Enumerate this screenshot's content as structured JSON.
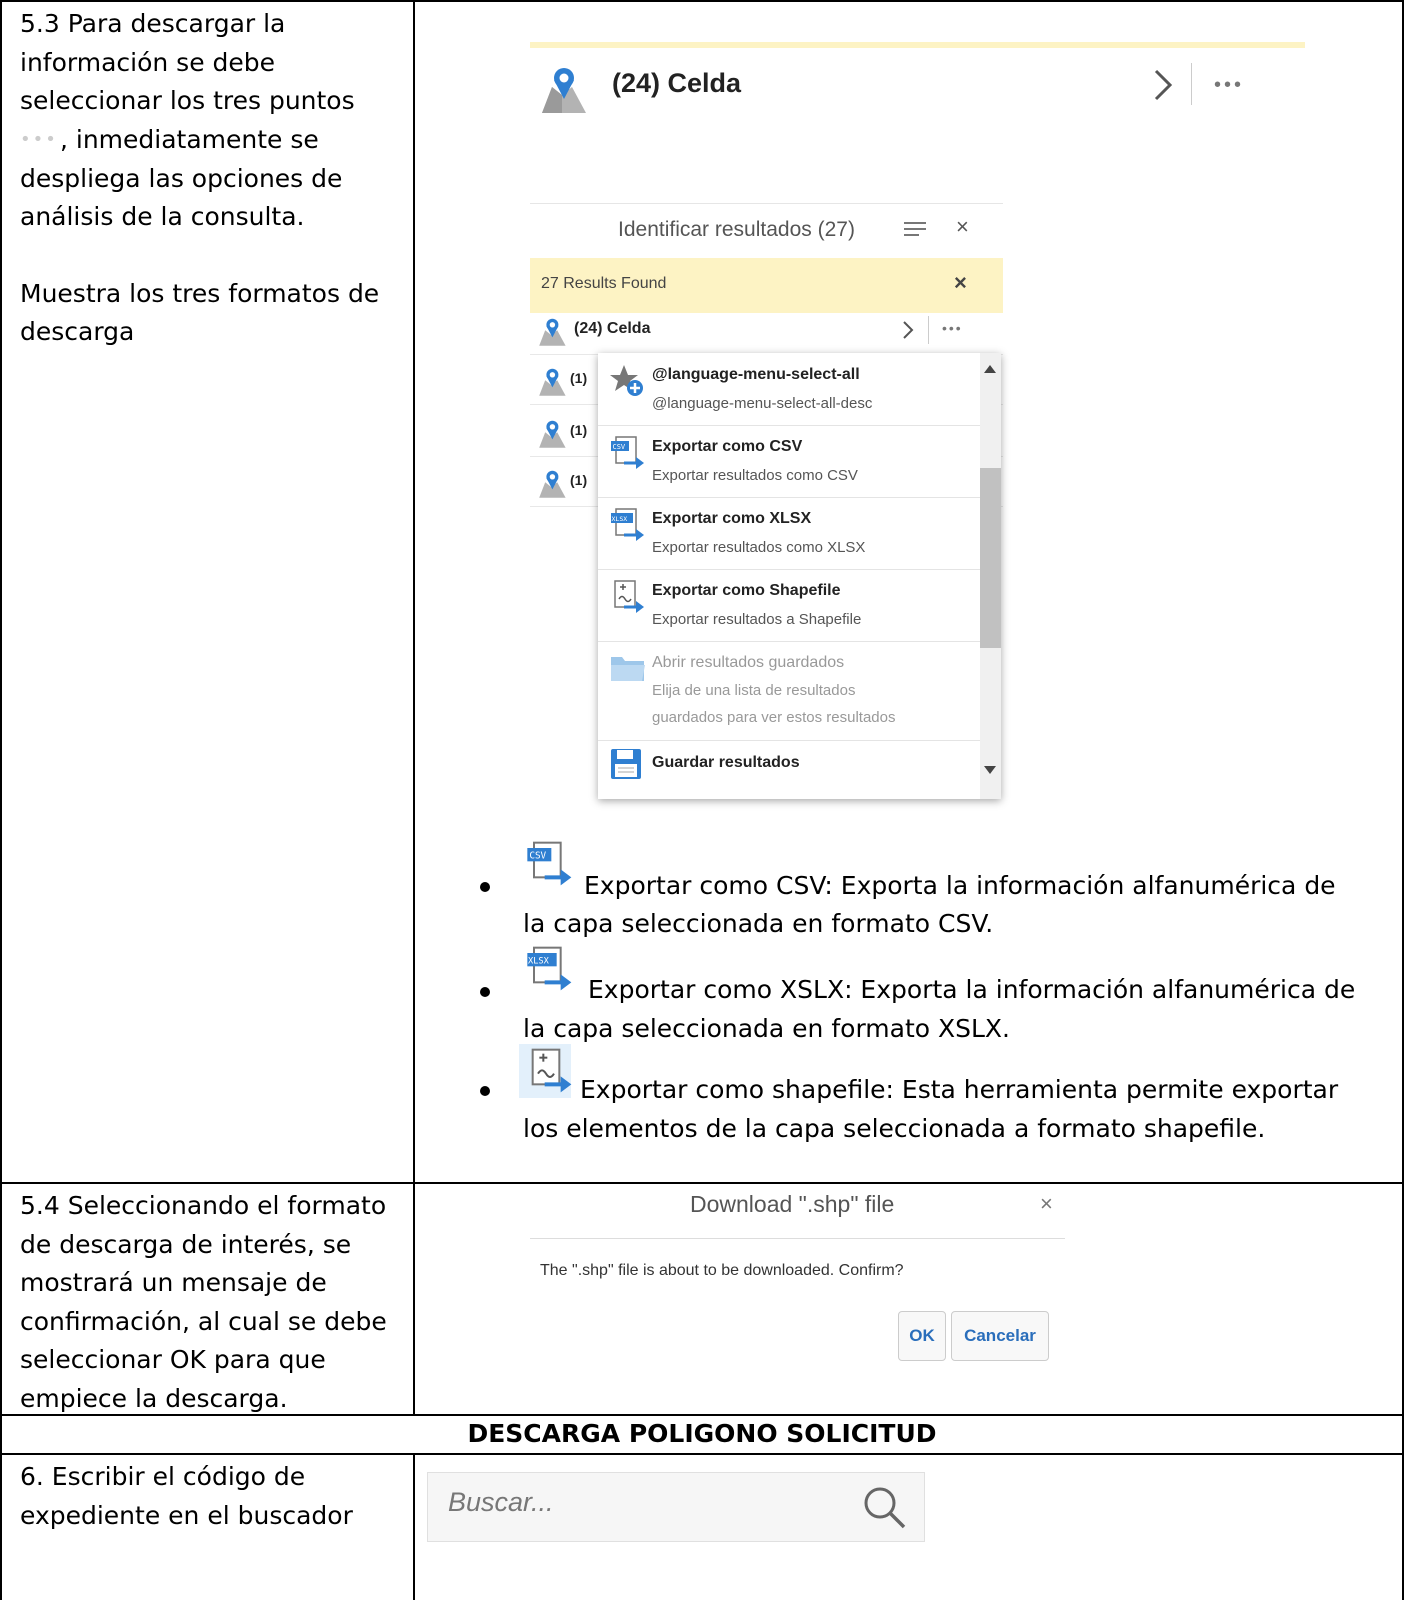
{
  "steps": {
    "s53": {
      "lines": [
        "5.3 Para descargar la",
        "información se debe",
        "seleccionar los tres puntos"
      ],
      "line4_dots": "•••",
      "line4_rest": ", inmediatamente se",
      "line5": "despliega las opciones de",
      "line6": "análisis de la consulta.",
      "para2_line1": "Muestra los tres formatos de",
      "para2_line2": "descarga"
    },
    "s54": {
      "lines": [
        "5.4 Seleccionando el formato",
        "de descarga de interés, se",
        "mostrará un mensaje de",
        "confirmación, al cual se debe",
        "seleccionar OK para que",
        "empiece la descarga."
      ]
    },
    "section_title": "DESCARGA POLIGONO SOLICITUD",
    "s6": {
      "lines": [
        "6. Escribir el código de",
        "expediente en el buscador"
      ]
    }
  },
  "top_result": {
    "title": "(24) Celda",
    "more": "•••"
  },
  "panel": {
    "title": "Identificar resultados (27)",
    "results_found": "27 Results Found",
    "rows": [
      {
        "label": "(24) Celda"
      },
      {
        "label": "(1)"
      },
      {
        "label": "(1)"
      },
      {
        "label": "(1)"
      }
    ],
    "more": "•••",
    "menu": [
      {
        "title": "@language-menu-select-all",
        "desc": "@language-menu-select-all-desc",
        "icon": "star-plus-icon"
      },
      {
        "title": "Exportar como CSV",
        "desc": "Exportar resultados como CSV",
        "icon": "csv-export-icon"
      },
      {
        "title": "Exportar como XLSX",
        "desc": "Exportar resultados como XLSX",
        "icon": "xlsx-export-icon"
      },
      {
        "title": "Exportar como Shapefile",
        "desc": "Exportar resultados a Shapefile",
        "icon": "shapefile-export-icon"
      },
      {
        "title": "Abrir resultados guardados",
        "desc1": "Elija de una lista de resultados",
        "desc2": "guardados para ver estos resultados",
        "icon": "folder-icon",
        "disabled": true
      },
      {
        "title": "Guardar resultados",
        "icon": "save-icon"
      }
    ]
  },
  "bullets": [
    {
      "line1": "Exportar como CSV: Exporta la información alfanumérica de",
      "line2": "la capa seleccionada en formato CSV.",
      "icon": "csv-export-icon"
    },
    {
      "line1": "Exportar como XSLX: Exporta la información alfanumérica de",
      "line2": "la capa seleccionada en formato XSLX.",
      "icon": "xlsx-export-icon"
    },
    {
      "line1": "Exportar como shapefile: Esta herramienta permite exportar",
      "line2": "los elementos de la capa seleccionada a formato shapefile.",
      "icon": "shapefile-export-icon"
    }
  ],
  "dialog": {
    "title": "Download \".shp\" file",
    "close": "×",
    "message": "The \".shp\" file is about to be downloaded. Confirm?",
    "ok": "OK",
    "cancel": "Cancelar"
  },
  "search": {
    "placeholder": "Buscar..."
  },
  "colors": {
    "highlight_yellow": "#fdf3c4",
    "link_blue": "#2a6ebb",
    "pin_blue": "#2f7fd1"
  }
}
